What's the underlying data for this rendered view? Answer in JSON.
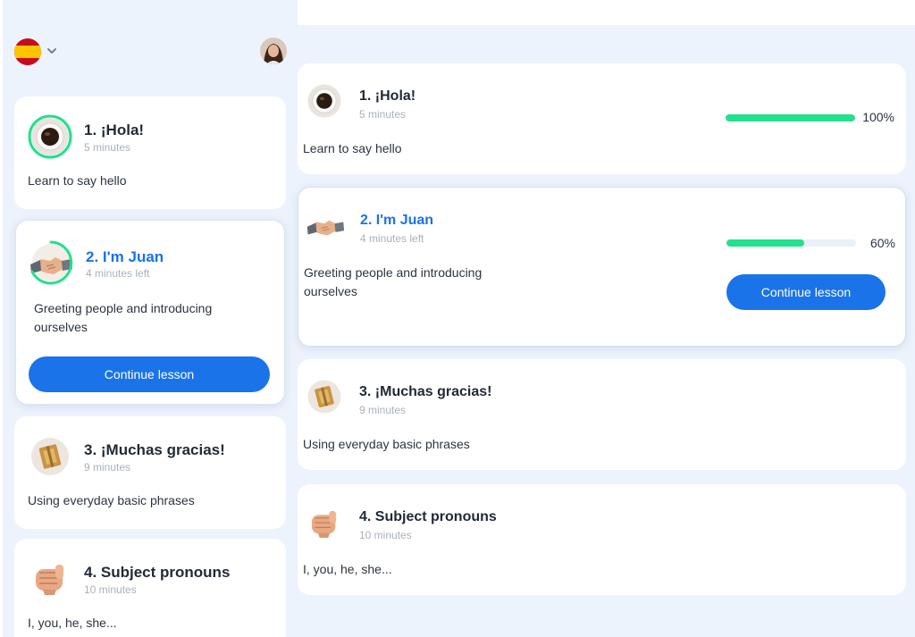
{
  "header": {
    "language_flag": "spain-flag-icon",
    "language_chevron": "chevron-down-icon",
    "avatar": "user-avatar"
  },
  "lessons": [
    {
      "title": "1. ¡Hola!",
      "duration": "5 minutes",
      "description": "Learn to say hello",
      "icon": "coffee-cup-icon",
      "progress": 100,
      "progress_label": "100%"
    },
    {
      "title": "2. I'm Juan",
      "duration": "4 minutes left",
      "description": "Greeting people and introducing ourselves",
      "icon": "handshake-icon",
      "progress": 60,
      "progress_label": "60%",
      "button": "Continue lesson"
    },
    {
      "title": "3. ¡Muchas gracias!",
      "duration": "9 minutes",
      "description": "Using everyday basic phrases",
      "icon": "gift-icon"
    },
    {
      "title": "4. Subject pronouns",
      "duration": "10 minutes",
      "description": "I, you, he, she...",
      "icon": "pointing-hand-icon"
    }
  ],
  "colors": {
    "accent": "#1a73e8",
    "progress": "#22e08c",
    "background": "#edf3fc"
  }
}
